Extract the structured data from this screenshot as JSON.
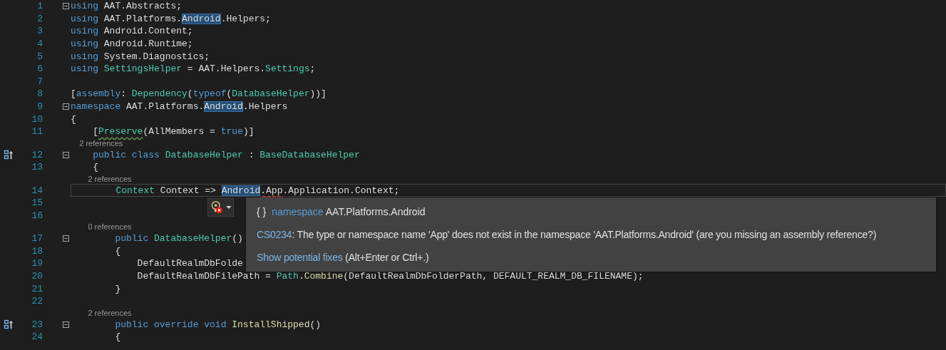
{
  "editor": {
    "lines": [
      {
        "number": "1",
        "fold": true,
        "glyph": false,
        "current": false,
        "tokens": [
          {
            "text": "using",
            "kind": "keyword"
          },
          {
            "text": " AAT.Abstracts;",
            "kind": "plain"
          }
        ]
      },
      {
        "number": "2",
        "fold": false,
        "glyph": false,
        "current": false,
        "tokens": [
          {
            "text": "using",
            "kind": "keyword"
          },
          {
            "text": " AAT.Platforms.",
            "kind": "plain"
          },
          {
            "text": "Android",
            "kind": "highlight"
          },
          {
            "text": ".Helpers;",
            "kind": "plain"
          }
        ]
      },
      {
        "number": "3",
        "fold": false,
        "glyph": false,
        "current": false,
        "tokens": [
          {
            "text": "using",
            "kind": "keyword"
          },
          {
            "text": " Android.Content;",
            "kind": "plain"
          }
        ]
      },
      {
        "number": "4",
        "fold": false,
        "glyph": false,
        "current": false,
        "tokens": [
          {
            "text": "using",
            "kind": "keyword"
          },
          {
            "text": " Android.Runtime;",
            "kind": "plain"
          }
        ]
      },
      {
        "number": "5",
        "fold": false,
        "glyph": false,
        "current": false,
        "tokens": [
          {
            "text": "using",
            "kind": "keyword"
          },
          {
            "text": " System.Diagnostics;",
            "kind": "plain"
          }
        ]
      },
      {
        "number": "6",
        "fold": false,
        "glyph": false,
        "current": false,
        "tokens": [
          {
            "text": "using",
            "kind": "keyword"
          },
          {
            "text": " SettingsHelper",
            "kind": "type"
          },
          {
            "text": " = AAT.Helpers.",
            "kind": "plain"
          },
          {
            "text": "Settings",
            "kind": "type"
          },
          {
            "text": ";",
            "kind": "plain"
          }
        ]
      },
      {
        "number": "7",
        "fold": false,
        "glyph": false,
        "current": false
      },
      {
        "number": "8",
        "fold": false,
        "glyph": false,
        "current": false,
        "tokens": [
          {
            "text": "[",
            "kind": "plain"
          },
          {
            "text": "assembly",
            "kind": "keyword"
          },
          {
            "text": ": ",
            "kind": "plain"
          },
          {
            "text": "Dependency",
            "kind": "type"
          },
          {
            "text": "(",
            "kind": "plain"
          },
          {
            "text": "typeof",
            "kind": "keyword"
          },
          {
            "text": "(",
            "kind": "plain"
          },
          {
            "text": "DatabaseHelper",
            "kind": "type"
          },
          {
            "text": "))]",
            "kind": "plain"
          }
        ]
      },
      {
        "number": "9",
        "fold": true,
        "glyph": false,
        "current": false,
        "tokens": [
          {
            "text": "namespace",
            "kind": "keyword"
          },
          {
            "text": " AAT.Platforms.",
            "kind": "plain"
          },
          {
            "text": "Android",
            "kind": "highlight"
          },
          {
            "text": ".Helpers",
            "kind": "plain"
          }
        ]
      },
      {
        "number": "10",
        "fold": false,
        "glyph": false,
        "current": false,
        "tokens": [
          {
            "text": "{",
            "kind": "plain"
          }
        ]
      },
      {
        "number": "11",
        "fold": false,
        "glyph": false,
        "current": false,
        "tokens": [
          {
            "text": "    [",
            "kind": "plain"
          },
          {
            "text": "Preserve",
            "kind": "type",
            "warning": true
          },
          {
            "text": "(AllMembers = ",
            "kind": "plain"
          },
          {
            "text": "true",
            "kind": "keyword"
          },
          {
            "text": ")]",
            "kind": "plain"
          }
        ]
      },
      {
        "codelens": "    2 references",
        "number": "12",
        "fold": true,
        "glyph": true,
        "current": false,
        "tokens": [
          {
            "text": "    public",
            "kind": "keyword"
          },
          {
            "text": " class",
            "kind": "keyword"
          },
          {
            "text": " DatabaseHelper",
            "kind": "type"
          },
          {
            "text": " : ",
            "kind": "plain"
          },
          {
            "text": "BaseDatabaseHelper",
            "kind": "type"
          }
        ]
      },
      {
        "number": "13",
        "fold": false,
        "glyph": false,
        "current": false,
        "tokens": [
          {
            "text": "    {",
            "kind": "plain"
          }
        ]
      },
      {
        "codelens": "        2 references",
        "number": "14",
        "fold": false,
        "glyph": false,
        "current": true,
        "tokens": [
          {
            "text": "        Context",
            "kind": "type"
          },
          {
            "text": " Context => ",
            "kind": "plain"
          },
          {
            "text": "Android",
            "kind": "highlight"
          },
          {
            "text": ".App",
            "kind": "plain",
            "error": true
          },
          {
            "text": ".Application.Context;",
            "kind": "plain"
          }
        ]
      },
      {
        "number": "15",
        "fold": false,
        "glyph": false,
        "current": false
      },
      {
        "number": "16",
        "fold": false,
        "glyph": false,
        "current": false
      },
      {
        "codelens": "        0 references",
        "number": "17",
        "fold": true,
        "glyph": false,
        "current": false,
        "tokens": [
          {
            "text": "        public",
            "kind": "keyword"
          },
          {
            "text": " DatabaseHelper",
            "kind": "type"
          },
          {
            "text": "()",
            "kind": "plain"
          }
        ]
      },
      {
        "number": "18",
        "fold": false,
        "glyph": false,
        "current": false,
        "tokens": [
          {
            "text": "        {",
            "kind": "plain"
          }
        ]
      },
      {
        "number": "19",
        "fold": false,
        "glyph": false,
        "current": false,
        "tokens": [
          {
            "text": "            DefaultRealmDbFolde",
            "kind": "plain"
          }
        ]
      },
      {
        "number": "20",
        "fold": false,
        "glyph": false,
        "current": false,
        "tokens": [
          {
            "text": "            DefaultRealmDbFilePath = ",
            "kind": "plain"
          },
          {
            "text": "Path",
            "kind": "type"
          },
          {
            "text": ".",
            "kind": "plain"
          },
          {
            "text": "Combine",
            "kind": "method"
          },
          {
            "text": "(DefaultRealmDbFolderPath, DEFAULT_REALM_DB_FILENAME);",
            "kind": "plain"
          }
        ]
      },
      {
        "number": "21",
        "fold": false,
        "glyph": false,
        "current": false,
        "tokens": [
          {
            "text": "        }",
            "kind": "plain"
          }
        ]
      },
      {
        "number": "22",
        "fold": false,
        "glyph": false,
        "current": false
      },
      {
        "codelens": "        2 references",
        "number": "23",
        "fold": true,
        "glyph": true,
        "current": false,
        "tokens": [
          {
            "text": "        public",
            "kind": "keyword"
          },
          {
            "text": " override",
            "kind": "keyword"
          },
          {
            "text": " void",
            "kind": "keyword"
          },
          {
            "text": " InstallShipped",
            "kind": "method"
          },
          {
            "text": "()",
            "kind": "plain"
          }
        ]
      },
      {
        "number": "24",
        "fold": false,
        "glyph": false,
        "current": false,
        "tokens": [
          {
            "text": "        {",
            "kind": "plain"
          }
        ]
      }
    ]
  },
  "quick_info": {
    "icon": "{ }",
    "keyword": "namespace",
    "name": "AAT.Platforms.Android",
    "error_code": "CS0234",
    "error_message": ": The type or namespace name 'App' does not exist in the namespace 'AAT.Platforms.Android' (are you missing an assembly reference?)",
    "fix_link": "Show potential fixes",
    "fix_shortcut": "(Alt+Enter or Ctrl+.)"
  }
}
